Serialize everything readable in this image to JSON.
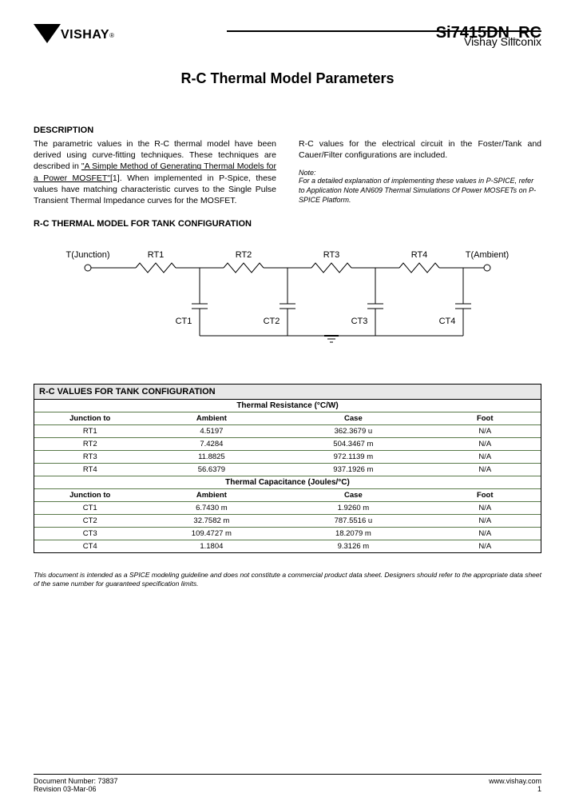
{
  "header": {
    "logo_text": "VISHAY",
    "reg": "®",
    "part_number": "Si7415DN_RC",
    "company": "Vishay Siliconix"
  },
  "title": "R-C Thermal Model Parameters",
  "desc_heading": "DESCRIPTION",
  "desc_left_1": "The parametric values in the R-C thermal model have been derived using curve-fitting techniques. These techniques are described in ",
  "desc_left_link": "\"A Simple Method of Generating Thermal Models for a Power MOSFET\"",
  "desc_left_2": "[1]. When implemented in P-Spice, these values have matching characteristic curves to the Single Pulse Transient Thermal Impedance curves for the MOSFET.",
  "desc_right": "R-C values for the electrical circuit in the Foster/Tank and Cauer/Filter configurations are included.",
  "note_label": "Note:",
  "note_text": "For a detailed explanation of implementing these values in P-SPICE, refer to Application Note AN609 Thermal Simulations Of Power MOSFETs on P-SPICE Platform.",
  "section_heading": "R-C THERMAL MODEL FOR TANK CONFIGURATION",
  "circuit": {
    "t_junction": "T(Junction)",
    "t_ambient": "T(Ambient)",
    "rt1": "RT1",
    "rt2": "RT2",
    "rt3": "RT3",
    "rt4": "RT4",
    "ct1": "CT1",
    "ct2": "CT2",
    "ct3": "CT3",
    "ct4": "CT4"
  },
  "table": {
    "title": "R-C VALUES FOR TANK CONFIGURATION",
    "sub_resistance": "Thermal Resistance (°C/W)",
    "sub_capacitance": "Thermal Capacitance (Joules/°C)",
    "col_junction": "Junction to",
    "col_ambient": "Ambient",
    "col_case": "Case",
    "col_foot": "Foot",
    "res_rows": [
      {
        "j": "RT1",
        "a": "4.5197",
        "c": "362.3679 u",
        "f": "N/A"
      },
      {
        "j": "RT2",
        "a": "7.4284",
        "c": "504.3467 m",
        "f": "N/A"
      },
      {
        "j": "RT3",
        "a": "11.8825",
        "c": "972.1139 m",
        "f": "N/A"
      },
      {
        "j": "RT4",
        "a": "56.6379",
        "c": "937.1926 m",
        "f": "N/A"
      }
    ],
    "cap_rows": [
      {
        "j": "CT1",
        "a": "6.7430 m",
        "c": "1.9260 m",
        "f": "N/A"
      },
      {
        "j": "CT2",
        "a": "32.7582 m",
        "c": "787.5516 u",
        "f": "N/A"
      },
      {
        "j": "CT3",
        "a": "109.4727 m",
        "c": "18.2079 m",
        "f": "N/A"
      },
      {
        "j": "CT4",
        "a": "1.1804",
        "c": "9.3126 m",
        "f": "N/A"
      }
    ]
  },
  "disclaimer": "This document is intended as a SPICE modeling guideline and does not constitute a commercial product data sheet. Designers should refer to the appropriate data sheet of the same number for guaranteed specification limits.",
  "footer": {
    "doc_number": "Document Number: 73837",
    "revision": "Revision 03-Mar-06",
    "url": "www.vishay.com",
    "page": "1"
  }
}
